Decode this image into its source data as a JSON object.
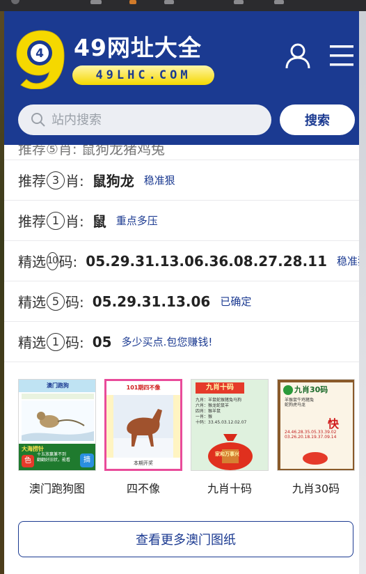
{
  "header": {
    "site_title": "49网址大全",
    "domain": "49LHC.COM",
    "search_placeholder": "站内搜索",
    "search_button": "搜索"
  },
  "predictions": [
    {
      "prefix": "推荐",
      "count": "③",
      "suffix": "肖:",
      "value": "鼠狗龙",
      "tag": "稳准狠"
    },
    {
      "prefix": "推荐",
      "count": "①",
      "suffix": "肖:",
      "value": "鼠",
      "tag": "重点多压"
    },
    {
      "prefix": "精选",
      "count": "⑩",
      "suffix": "码:",
      "value": "05.29.31.13.06.36.08.27.28.11",
      "tag": "稳准狠"
    },
    {
      "prefix": "精选",
      "count": "⑤",
      "suffix": "码:",
      "value": "05.29.31.13.06",
      "tag": "已确定"
    },
    {
      "prefix": "精选",
      "count": "①",
      "suffix": "码:",
      "value": "05",
      "tag": "多少买点.包您赚钱!"
    }
  ],
  "gallery": [
    {
      "caption": "澳门跑狗图",
      "inner_title": "澳门跑狗",
      "corner": "摘",
      "footer": "大海捞针"
    },
    {
      "caption": "四不像",
      "inner_title": "101期四不像",
      "footer": "本期开奖"
    },
    {
      "caption": "九肖十码",
      "inner_title": "九肖十码",
      "footer": "家和万事兴"
    },
    {
      "caption": "九肖30码",
      "inner_title": "九肖30码",
      "corner": "快"
    }
  ],
  "more_button": "查看更多澳门图纸",
  "colors": {
    "brand_blue": "#1b3a91",
    "pill_yellow": "#f5d800"
  }
}
